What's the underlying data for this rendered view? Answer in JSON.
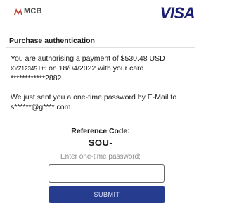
{
  "header": {
    "bank_logo_text": "MCB",
    "card_brand": "VISA"
  },
  "auth": {
    "title": "Purchase authentication",
    "payment_line": "You are authorising a payment of $530.48 USD",
    "merchant": "XYZ12345 Ltd",
    "date_line": " on 18/04/2022 with your card",
    "card_number": "************2882.",
    "otp_sent_line": "We just sent you a one-time password by E-Mail to",
    "email_masked": "s******@g****.com."
  },
  "reference": {
    "label": "Reference Code:",
    "code": "SOU-"
  },
  "otp": {
    "label": "Enter one-time password:",
    "value": ""
  },
  "actions": {
    "submit_label": "SUBMIT"
  },
  "colors": {
    "visa_blue": "#1a1f71",
    "submit_bg": "#263c8f",
    "mcb_red": "#c0392b"
  }
}
